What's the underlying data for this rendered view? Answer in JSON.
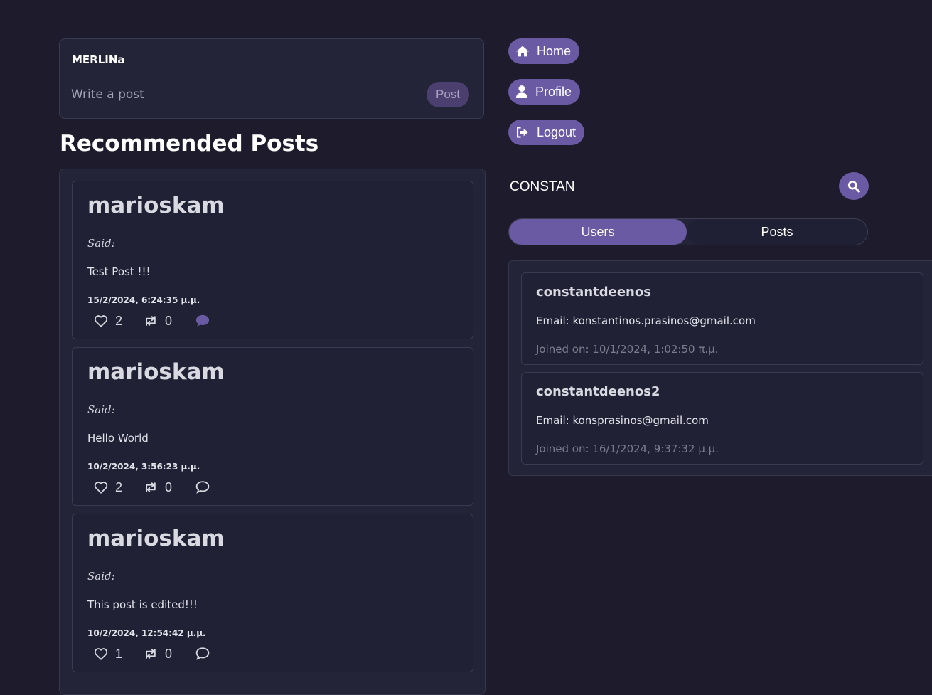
{
  "composer": {
    "username": "MERLINa",
    "placeholder": "Write a post",
    "post_label": "Post"
  },
  "feed": {
    "title": "Recommended Posts",
    "posts": [
      {
        "author": "marioskam",
        "said": "Said:",
        "content": "Test Post !!!",
        "date": "15/2/2024, 6:24:35 μ.μ.",
        "likes": "2",
        "reposts": "0",
        "comment_icon": "comment-filled-icon"
      },
      {
        "author": "marioskam",
        "said": "Said:",
        "content": "Hello World",
        "date": "10/2/2024, 3:56:23 μ.μ.",
        "likes": "2",
        "reposts": "0",
        "comment_icon": "comment-outline-icon"
      },
      {
        "author": "marioskam",
        "said": "Said:",
        "content": "This post is edited!!!",
        "date": "10/2/2024, 12:54:42 μ.μ.",
        "likes": "1",
        "reposts": "0",
        "comment_icon": "comment-outline-icon"
      }
    ]
  },
  "nav": {
    "home_label": "Home",
    "profile_label": "Profile",
    "logout_label": "Logout"
  },
  "search": {
    "value": "CONSTAN"
  },
  "tabs": {
    "users_label": "Users",
    "posts_label": "Posts",
    "active": "Users"
  },
  "results": {
    "users": [
      {
        "username": "constantdeenos",
        "email": "Email: konstantinos.prasinos@gmail.com",
        "joined": "Joined on: 10/1/2024, 1:02:50 π.μ."
      },
      {
        "username": "constantdeenos2",
        "email": "Email: konsprasinos@gmail.com",
        "joined": "Joined on: 16/1/2024, 9:37:32 μ.μ."
      }
    ]
  },
  "colors": {
    "background": "#1e1c2c",
    "card": "#232437",
    "accent": "#6a5aa3",
    "post_button": "#4a3f6e"
  }
}
